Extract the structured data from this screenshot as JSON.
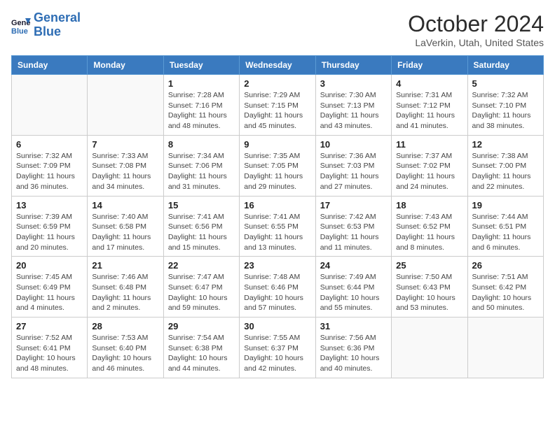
{
  "header": {
    "logo_line1": "General",
    "logo_line2": "Blue",
    "month_title": "October 2024",
    "location": "LaVerkin, Utah, United States"
  },
  "days_of_week": [
    "Sunday",
    "Monday",
    "Tuesday",
    "Wednesday",
    "Thursday",
    "Friday",
    "Saturday"
  ],
  "weeks": [
    [
      {
        "day": "",
        "info": ""
      },
      {
        "day": "",
        "info": ""
      },
      {
        "day": "1",
        "info": "Sunrise: 7:28 AM\nSunset: 7:16 PM\nDaylight: 11 hours and 48 minutes."
      },
      {
        "day": "2",
        "info": "Sunrise: 7:29 AM\nSunset: 7:15 PM\nDaylight: 11 hours and 45 minutes."
      },
      {
        "day": "3",
        "info": "Sunrise: 7:30 AM\nSunset: 7:13 PM\nDaylight: 11 hours and 43 minutes."
      },
      {
        "day": "4",
        "info": "Sunrise: 7:31 AM\nSunset: 7:12 PM\nDaylight: 11 hours and 41 minutes."
      },
      {
        "day": "5",
        "info": "Sunrise: 7:32 AM\nSunset: 7:10 PM\nDaylight: 11 hours and 38 minutes."
      }
    ],
    [
      {
        "day": "6",
        "info": "Sunrise: 7:32 AM\nSunset: 7:09 PM\nDaylight: 11 hours and 36 minutes."
      },
      {
        "day": "7",
        "info": "Sunrise: 7:33 AM\nSunset: 7:08 PM\nDaylight: 11 hours and 34 minutes."
      },
      {
        "day": "8",
        "info": "Sunrise: 7:34 AM\nSunset: 7:06 PM\nDaylight: 11 hours and 31 minutes."
      },
      {
        "day": "9",
        "info": "Sunrise: 7:35 AM\nSunset: 7:05 PM\nDaylight: 11 hours and 29 minutes."
      },
      {
        "day": "10",
        "info": "Sunrise: 7:36 AM\nSunset: 7:03 PM\nDaylight: 11 hours and 27 minutes."
      },
      {
        "day": "11",
        "info": "Sunrise: 7:37 AM\nSunset: 7:02 PM\nDaylight: 11 hours and 24 minutes."
      },
      {
        "day": "12",
        "info": "Sunrise: 7:38 AM\nSunset: 7:00 PM\nDaylight: 11 hours and 22 minutes."
      }
    ],
    [
      {
        "day": "13",
        "info": "Sunrise: 7:39 AM\nSunset: 6:59 PM\nDaylight: 11 hours and 20 minutes."
      },
      {
        "day": "14",
        "info": "Sunrise: 7:40 AM\nSunset: 6:58 PM\nDaylight: 11 hours and 17 minutes."
      },
      {
        "day": "15",
        "info": "Sunrise: 7:41 AM\nSunset: 6:56 PM\nDaylight: 11 hours and 15 minutes."
      },
      {
        "day": "16",
        "info": "Sunrise: 7:41 AM\nSunset: 6:55 PM\nDaylight: 11 hours and 13 minutes."
      },
      {
        "day": "17",
        "info": "Sunrise: 7:42 AM\nSunset: 6:53 PM\nDaylight: 11 hours and 11 minutes."
      },
      {
        "day": "18",
        "info": "Sunrise: 7:43 AM\nSunset: 6:52 PM\nDaylight: 11 hours and 8 minutes."
      },
      {
        "day": "19",
        "info": "Sunrise: 7:44 AM\nSunset: 6:51 PM\nDaylight: 11 hours and 6 minutes."
      }
    ],
    [
      {
        "day": "20",
        "info": "Sunrise: 7:45 AM\nSunset: 6:49 PM\nDaylight: 11 hours and 4 minutes."
      },
      {
        "day": "21",
        "info": "Sunrise: 7:46 AM\nSunset: 6:48 PM\nDaylight: 11 hours and 2 minutes."
      },
      {
        "day": "22",
        "info": "Sunrise: 7:47 AM\nSunset: 6:47 PM\nDaylight: 10 hours and 59 minutes."
      },
      {
        "day": "23",
        "info": "Sunrise: 7:48 AM\nSunset: 6:46 PM\nDaylight: 10 hours and 57 minutes."
      },
      {
        "day": "24",
        "info": "Sunrise: 7:49 AM\nSunset: 6:44 PM\nDaylight: 10 hours and 55 minutes."
      },
      {
        "day": "25",
        "info": "Sunrise: 7:50 AM\nSunset: 6:43 PM\nDaylight: 10 hours and 53 minutes."
      },
      {
        "day": "26",
        "info": "Sunrise: 7:51 AM\nSunset: 6:42 PM\nDaylight: 10 hours and 50 minutes."
      }
    ],
    [
      {
        "day": "27",
        "info": "Sunrise: 7:52 AM\nSunset: 6:41 PM\nDaylight: 10 hours and 48 minutes."
      },
      {
        "day": "28",
        "info": "Sunrise: 7:53 AM\nSunset: 6:40 PM\nDaylight: 10 hours and 46 minutes."
      },
      {
        "day": "29",
        "info": "Sunrise: 7:54 AM\nSunset: 6:38 PM\nDaylight: 10 hours and 44 minutes."
      },
      {
        "day": "30",
        "info": "Sunrise: 7:55 AM\nSunset: 6:37 PM\nDaylight: 10 hours and 42 minutes."
      },
      {
        "day": "31",
        "info": "Sunrise: 7:56 AM\nSunset: 6:36 PM\nDaylight: 10 hours and 40 minutes."
      },
      {
        "day": "",
        "info": ""
      },
      {
        "day": "",
        "info": ""
      }
    ]
  ]
}
